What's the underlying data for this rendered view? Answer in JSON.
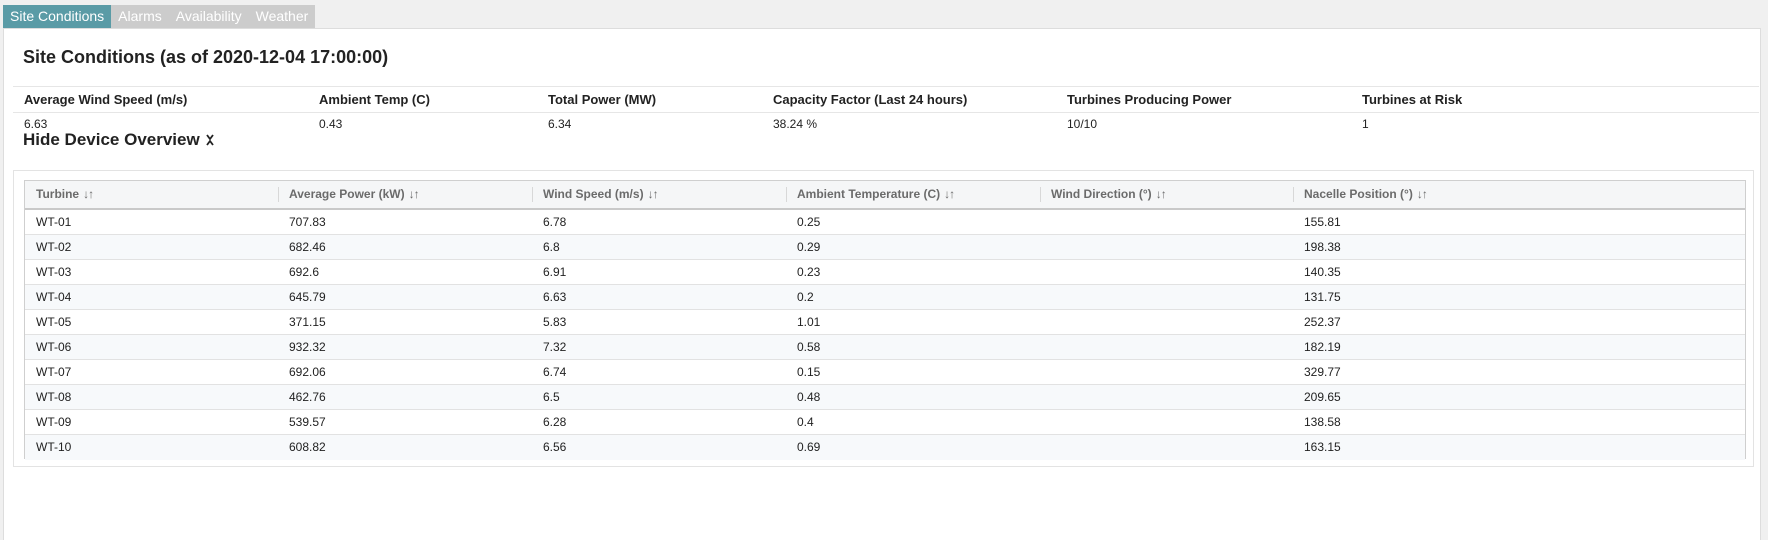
{
  "tabs": [
    {
      "label": "Site Conditions",
      "active": true
    },
    {
      "label": "Alarms",
      "active": false
    },
    {
      "label": "Availability",
      "active": false
    },
    {
      "label": "Weather",
      "active": false
    }
  ],
  "site": {
    "title": "Site Conditions (as of 2020-12-04 17:00:00)"
  },
  "kpis": {
    "headers": [
      "Average Wind Speed (m/s)",
      "Ambient Temp (C)",
      "Total Power (MW)",
      "Capacity Factor (Last 24 hours)",
      "Turbines Producing Power",
      "Turbines at Risk"
    ],
    "values": [
      "6.63",
      "0.43",
      "6.34",
      "38.24 %",
      "10/10",
      "1"
    ]
  },
  "device_overview": {
    "toggle_label": "Hide Device Overview",
    "toggle_icon": "double-chevron-collapse-icon"
  },
  "table": {
    "sort_icon": "↓↑",
    "columns": [
      "Turbine",
      "Average Power (kW)",
      "Wind Speed (m/s)",
      "Ambient Temperature (C)",
      "Wind Direction (°)",
      "Nacelle Position (°)"
    ],
    "rows": [
      [
        "WT-01",
        "707.83",
        "6.78",
        "0.25",
        "",
        "155.81"
      ],
      [
        "WT-02",
        "682.46",
        "6.8",
        "0.29",
        "",
        "198.38"
      ],
      [
        "WT-03",
        "692.6",
        "6.91",
        "0.23",
        "",
        "140.35"
      ],
      [
        "WT-04",
        "645.79",
        "6.63",
        "0.2",
        "",
        "131.75"
      ],
      [
        "WT-05",
        "371.15",
        "5.83",
        "1.01",
        "",
        "252.37"
      ],
      [
        "WT-06",
        "932.32",
        "7.32",
        "0.58",
        "",
        "182.19"
      ],
      [
        "WT-07",
        "692.06",
        "6.74",
        "0.15",
        "",
        "329.77"
      ],
      [
        "WT-08",
        "462.76",
        "6.5",
        "0.48",
        "",
        "209.65"
      ],
      [
        "WT-09",
        "539.57",
        "6.28",
        "0.4",
        "",
        "138.58"
      ],
      [
        "WT-10",
        "608.82",
        "6.56",
        "0.69",
        "",
        "163.15"
      ]
    ]
  }
}
